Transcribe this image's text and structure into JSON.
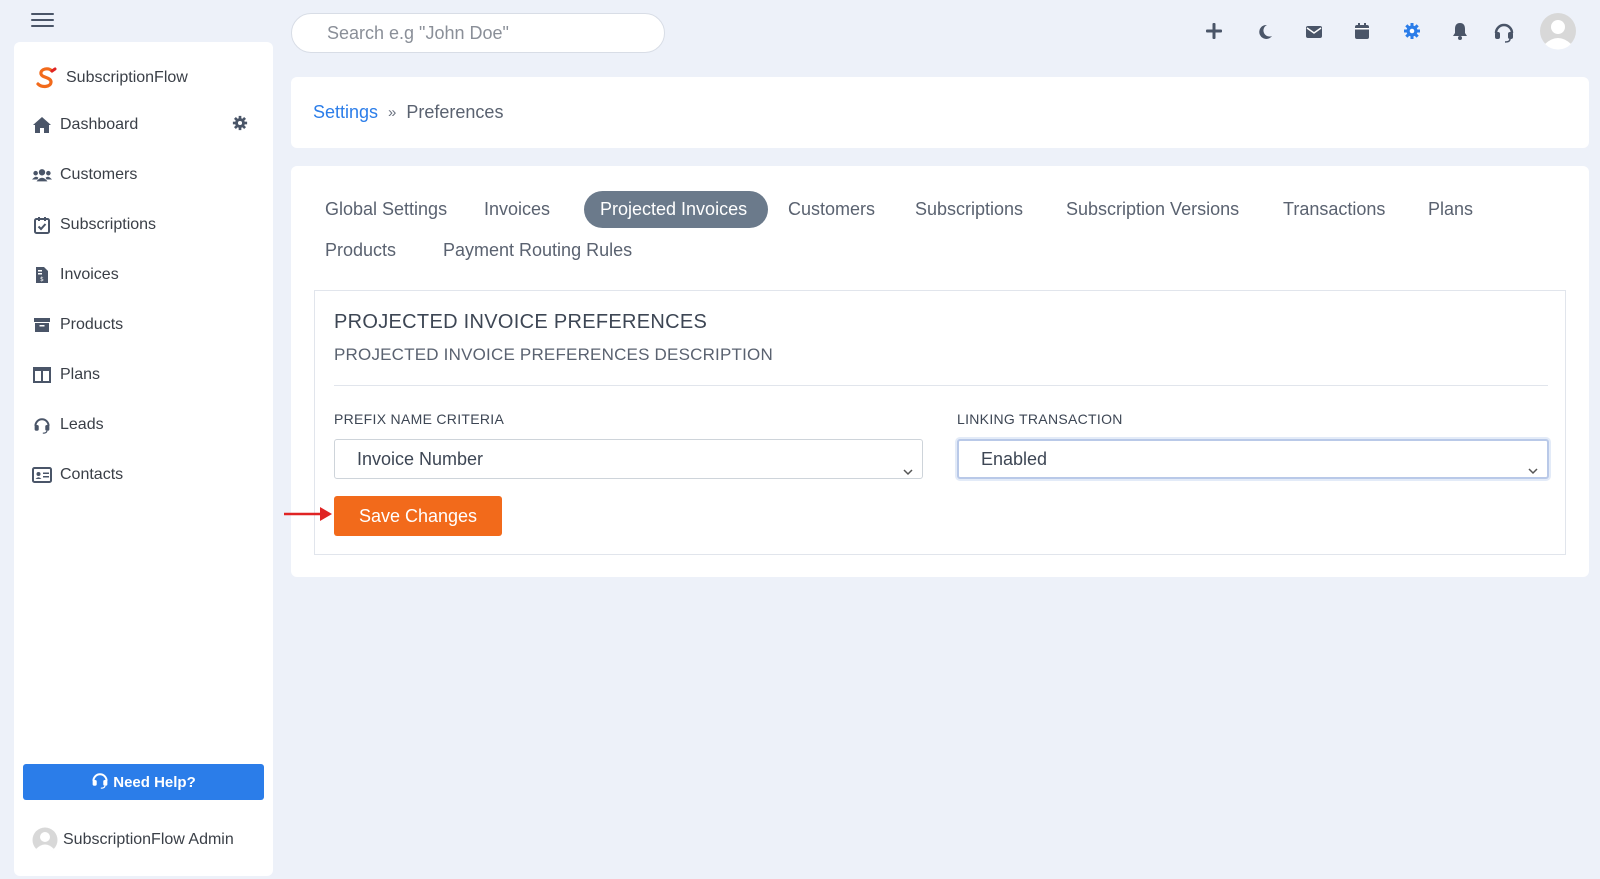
{
  "topbar": {
    "search_placeholder": "Search e.g \"John Doe\"",
    "icons": [
      "plus-icon",
      "moon-icon",
      "envelope-icon",
      "calendar-icon",
      "gear-icon",
      "bell-icon",
      "headset-icon",
      "avatar"
    ]
  },
  "sidebar": {
    "brand": "SubscriptionFlow",
    "items": [
      {
        "label": "Dashboard",
        "icon": "home-icon"
      },
      {
        "label": "Customers",
        "icon": "users-icon"
      },
      {
        "label": "Subscriptions",
        "icon": "calendar-check-icon"
      },
      {
        "label": "Invoices",
        "icon": "invoice-icon"
      },
      {
        "label": "Products",
        "icon": "archive-icon"
      },
      {
        "label": "Plans",
        "icon": "columns-icon"
      },
      {
        "label": "Leads",
        "icon": "headset-icon"
      },
      {
        "label": "Contacts",
        "icon": "id-card-icon"
      }
    ],
    "help_label": "Need Help?",
    "admin_name": "SubscriptionFlow Admin"
  },
  "breadcrumb": {
    "parent": "Settings",
    "separator": "»",
    "current": "Preferences"
  },
  "tabs": [
    "Global Settings",
    "Invoices",
    "Projected Invoices",
    "Customers",
    "Subscriptions",
    "Subscription Versions",
    "Transactions",
    "Plans",
    "Products",
    "Payment Routing Rules"
  ],
  "active_tab": "Projected Invoices",
  "preferences": {
    "title": "PROJECTED INVOICE PREFERENCES",
    "description": "PROJECTED INVOICE PREFERENCES DESCRIPTION",
    "prefix_label": "PREFIX NAME CRITERIA",
    "prefix_value": "Invoice Number",
    "linking_label": "LINKING TRANSACTION",
    "linking_value": "Enabled",
    "save_label": "Save Changes"
  },
  "colors": {
    "accent_blue": "#2b7de9",
    "save_orange": "#f26a1b",
    "active_tab": "#6b7a8b",
    "annotation_arrow": "#e02424"
  }
}
